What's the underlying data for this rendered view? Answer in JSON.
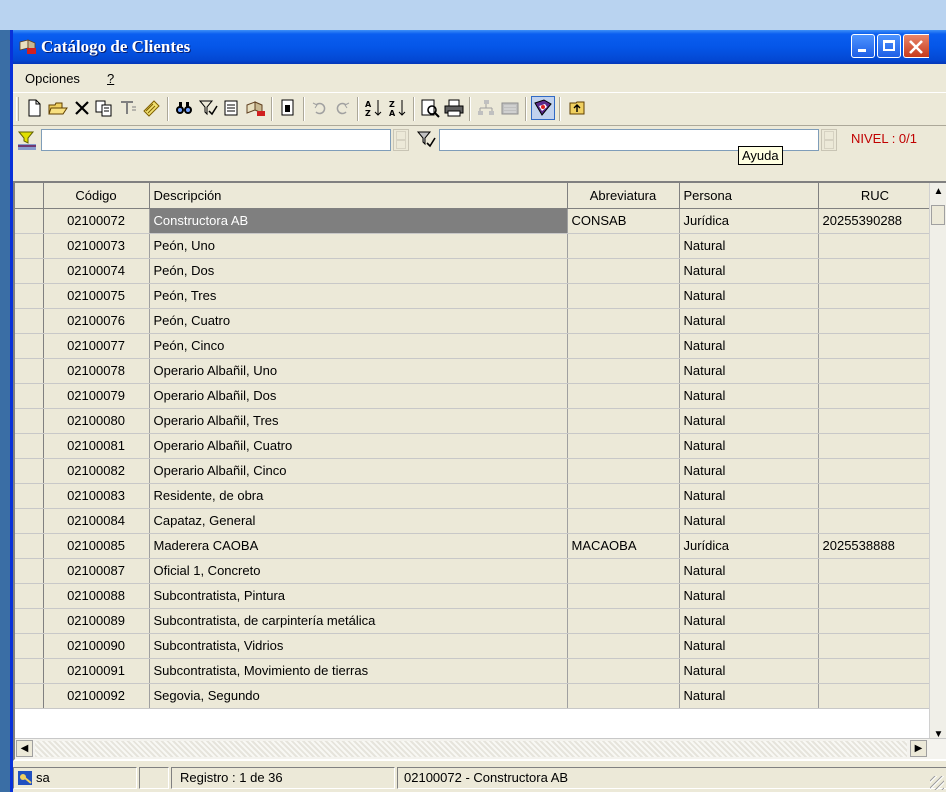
{
  "window": {
    "title": "Catálogo de Clientes",
    "accent": "#0556e8"
  },
  "menu": {
    "items": [
      {
        "label": "Opciones"
      },
      {
        "label": "?"
      }
    ]
  },
  "toolbar": {
    "icons": [
      "new-icon",
      "open-icon",
      "delete-icon",
      "copy-icon",
      "filter-column-icon",
      "edit-icon",
      "find-icon",
      "filter-icon",
      "print-setup-icon",
      "client-icon",
      "notes-icon",
      "undo-icon",
      "redo-icon",
      "sort-asc-icon",
      "sort-desc-icon",
      "print-preview-icon",
      "printer-icon",
      "tree-icon",
      "calculator-icon",
      "help-icon",
      "exit-icon"
    ]
  },
  "filter": {
    "value_left": "",
    "value_right": "",
    "tooltip": "Ayuda",
    "nivel": "NIVEL : 0/1"
  },
  "grid": {
    "columns": [
      "Código",
      "Descripción",
      "Abreviatura",
      "Persona",
      "RUC"
    ],
    "rows": [
      {
        "code": "02100072",
        "desc": "Constructora AB",
        "abbr": "CONSAB",
        "persona": "Jurídica",
        "ruc": "20255390288"
      },
      {
        "code": "02100073",
        "desc": "Peón, Uno",
        "abbr": "",
        "persona": "Natural",
        "ruc": ""
      },
      {
        "code": "02100074",
        "desc": "Peón, Dos",
        "abbr": "",
        "persona": "Natural",
        "ruc": ""
      },
      {
        "code": "02100075",
        "desc": "Peón, Tres",
        "abbr": "",
        "persona": "Natural",
        "ruc": ""
      },
      {
        "code": "02100076",
        "desc": "Peón, Cuatro",
        "abbr": "",
        "persona": "Natural",
        "ruc": ""
      },
      {
        "code": "02100077",
        "desc": "Peón, Cinco",
        "abbr": "",
        "persona": "Natural",
        "ruc": ""
      },
      {
        "code": "02100078",
        "desc": "Operario Albañil, Uno",
        "abbr": "",
        "persona": "Natural",
        "ruc": ""
      },
      {
        "code": "02100079",
        "desc": "Operario Albañil, Dos",
        "abbr": "",
        "persona": "Natural",
        "ruc": ""
      },
      {
        "code": "02100080",
        "desc": "Operario Albañil, Tres",
        "abbr": "",
        "persona": "Natural",
        "ruc": ""
      },
      {
        "code": "02100081",
        "desc": "Operario Albañil, Cuatro",
        "abbr": "",
        "persona": "Natural",
        "ruc": ""
      },
      {
        "code": "02100082",
        "desc": "Operario Albañil, Cinco",
        "abbr": "",
        "persona": "Natural",
        "ruc": ""
      },
      {
        "code": "02100083",
        "desc": "Residente, de obra",
        "abbr": "",
        "persona": "Natural",
        "ruc": ""
      },
      {
        "code": "02100084",
        "desc": "Capataz, General",
        "abbr": "",
        "persona": "Natural",
        "ruc": ""
      },
      {
        "code": "02100085",
        "desc": "Maderera CAOBA",
        "abbr": "MACAOBA",
        "persona": "Jurídica",
        "ruc": "2025538888"
      },
      {
        "code": "02100087",
        "desc": "Oficial 1, Concreto",
        "abbr": "",
        "persona": "Natural",
        "ruc": ""
      },
      {
        "code": "02100088",
        "desc": "Subcontratista, Pintura",
        "abbr": "",
        "persona": "Natural",
        "ruc": ""
      },
      {
        "code": "02100089",
        "desc": "Subcontratista, de carpintería metálica",
        "abbr": "",
        "persona": "Natural",
        "ruc": ""
      },
      {
        "code": "02100090",
        "desc": "Subcontratista, Vidrios",
        "abbr": "",
        "persona": "Natural",
        "ruc": ""
      },
      {
        "code": "02100091",
        "desc": "Subcontratista, Movimiento de tierras",
        "abbr": "",
        "persona": "Natural",
        "ruc": ""
      },
      {
        "code": "02100092",
        "desc": "Segovia, Segundo",
        "abbr": "",
        "persona": "Natural",
        "ruc": ""
      }
    ]
  },
  "status": {
    "user": "sa",
    "registro": "Registro :  1 de  36",
    "current": "02100072 - Constructora AB"
  }
}
